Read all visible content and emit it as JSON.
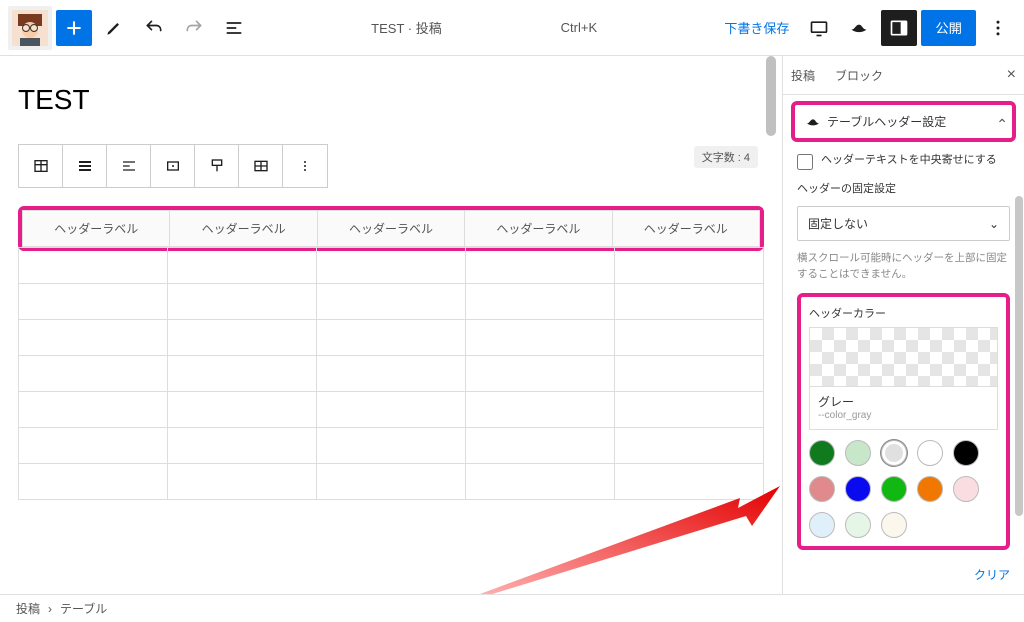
{
  "topbar": {
    "doc_title": "TEST · 投稿",
    "shortcut": "Ctrl+K",
    "save_draft": "下書き保存",
    "publish": "公開"
  },
  "editor": {
    "post_title": "TEST",
    "char_count": "文字数 : 4",
    "header_labels": [
      "ヘッダーラベル",
      "ヘッダーラベル",
      "ヘッダーラベル",
      "ヘッダーラベル",
      "ヘッダーラベル"
    ]
  },
  "sidebar": {
    "tabs": {
      "post": "投稿",
      "block": "ブロック"
    },
    "panel_title": "テーブルヘッダー設定",
    "center_header_text": "ヘッダーテキストを中央寄せにする",
    "sticky_label": "ヘッダーの固定設定",
    "sticky_value": "固定しない",
    "sticky_help": "横スクロール可能時にヘッダーを上部に固定することはできません。",
    "header_color_label": "ヘッダーカラー",
    "selected_color_name": "グレー",
    "selected_color_var": "--color_gray",
    "swatches": [
      {
        "name": "dark-green",
        "hex": "#0f7a1e"
      },
      {
        "name": "light-green",
        "hex": "#c8e6c9"
      },
      {
        "name": "gray",
        "hex": "#e0e0e0",
        "ring": true
      },
      {
        "name": "white",
        "hex": "#ffffff"
      },
      {
        "name": "black",
        "hex": "#000000"
      },
      {
        "name": "pink",
        "hex": "#e08a8d"
      },
      {
        "name": "blue",
        "hex": "#0a0af0"
      },
      {
        "name": "green",
        "hex": "#12b812"
      },
      {
        "name": "orange",
        "hex": "#f07800"
      },
      {
        "name": "light-pink",
        "hex": "#fadde0"
      },
      {
        "name": "pale-blue",
        "hex": "#e0f0fa"
      },
      {
        "name": "pale-green",
        "hex": "#e6f6e6"
      },
      {
        "name": "cream",
        "hex": "#fbf7ed"
      }
    ],
    "clear": "クリア"
  },
  "footer": {
    "crumb1": "投稿",
    "sep": "›",
    "crumb2": "テーブル"
  }
}
